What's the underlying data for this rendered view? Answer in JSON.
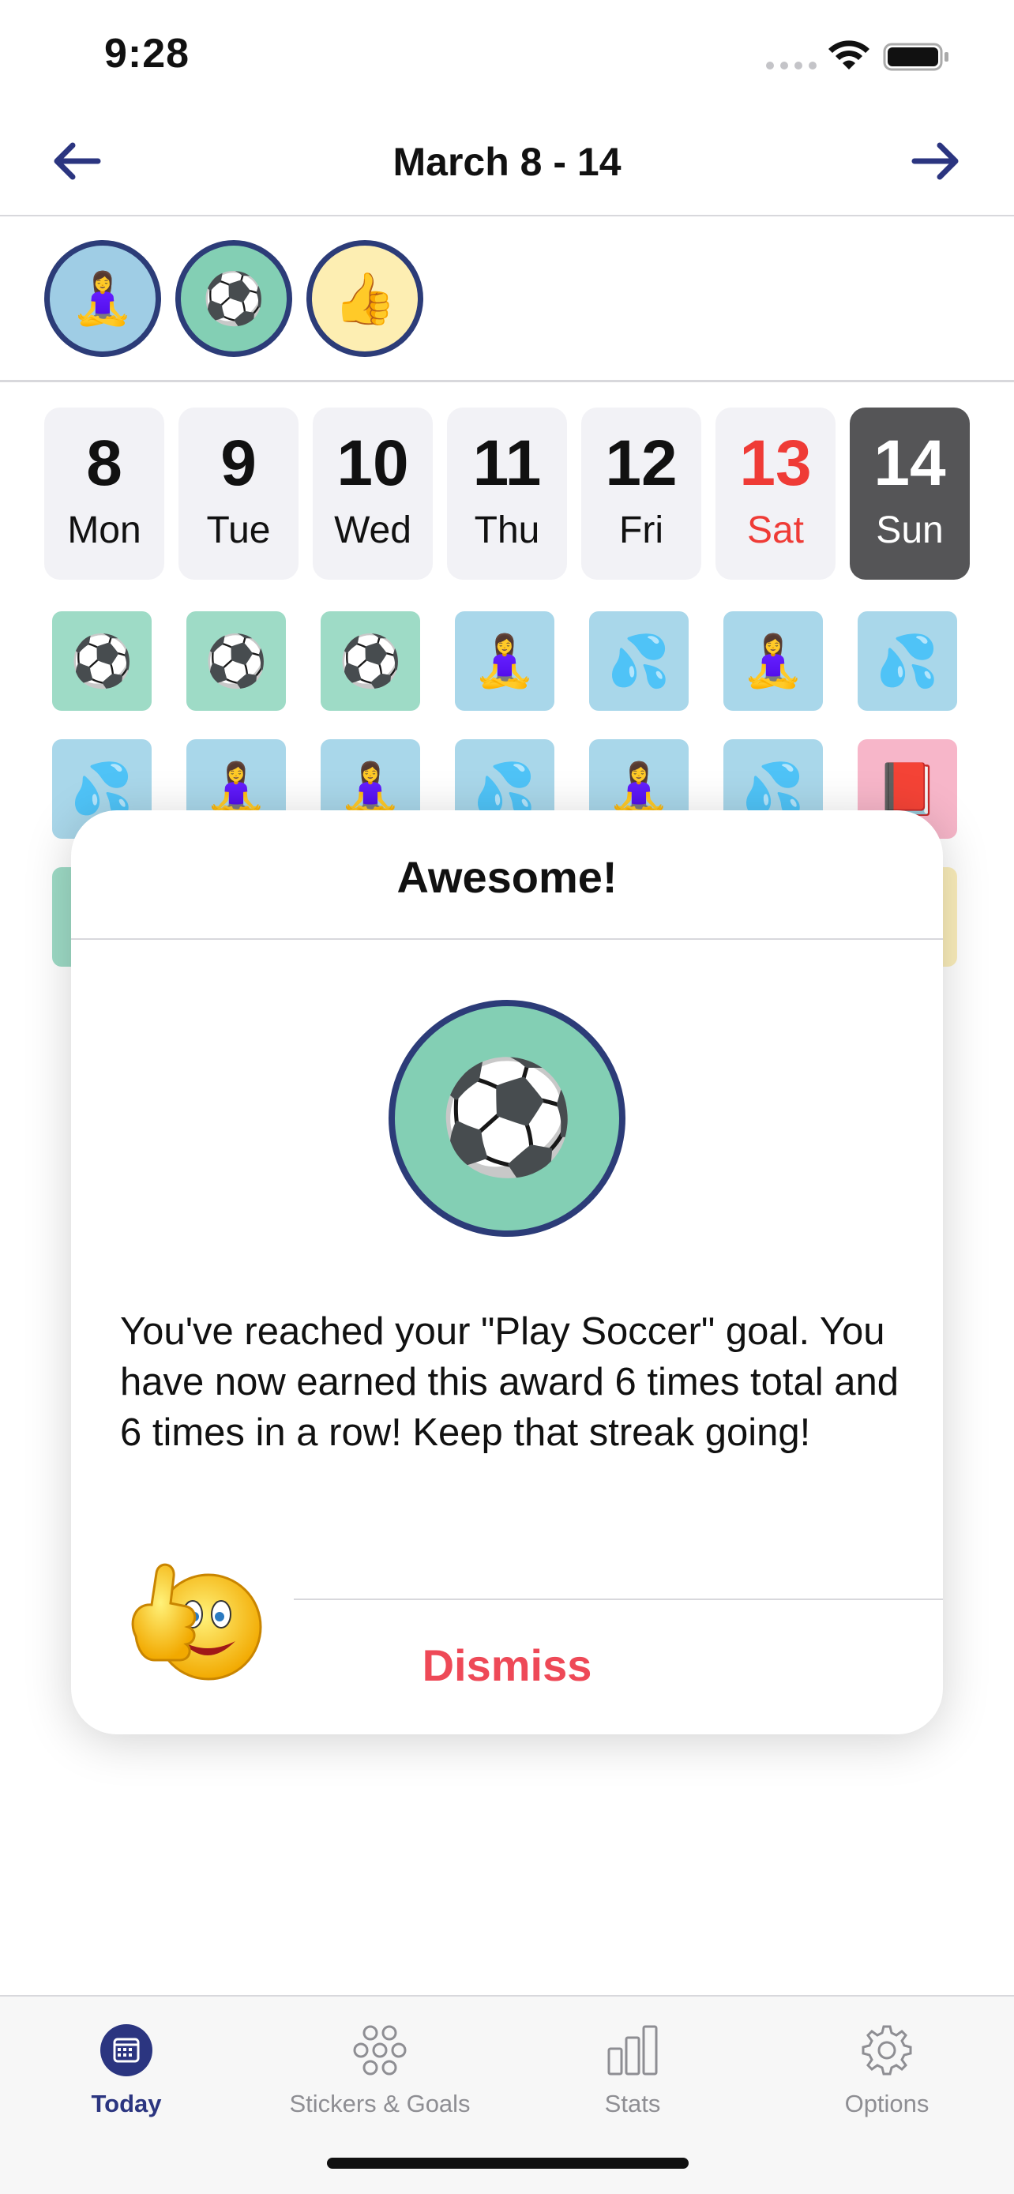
{
  "status_bar": {
    "time": "9:28"
  },
  "header": {
    "title": "March 8 - 14",
    "prev_icon": "arrow-left-icon",
    "next_icon": "arrow-right-icon"
  },
  "award_strip": [
    {
      "emoji": "🧘‍♀️",
      "bg": "#9fcde5"
    },
    {
      "emoji": "⚽",
      "bg": "#83cfb4"
    },
    {
      "emoji": "👍",
      "bg": "#fdeeb2"
    }
  ],
  "days": [
    {
      "num": "8",
      "name": "Mon"
    },
    {
      "num": "9",
      "name": "Tue"
    },
    {
      "num": "10",
      "name": "Wed"
    },
    {
      "num": "11",
      "name": "Thu"
    },
    {
      "num": "12",
      "name": "Fri"
    },
    {
      "num": "13",
      "name": "Sat"
    },
    {
      "num": "14",
      "name": "Sun"
    }
  ],
  "sticker_rows": [
    [
      "⚽",
      "⚽",
      "⚽",
      "🧘‍♀️",
      "💦",
      "🧘‍♀️",
      "💦"
    ],
    [
      "💦",
      "🧘‍♀️",
      "🧘‍♀️",
      "💦",
      "🧘‍♀️",
      "💦",
      "📕"
    ]
  ],
  "colors": {
    "soccer_bg": "#9edbc6",
    "blue_bg": "#a9d7ea",
    "book_bg": "#f7b6c9",
    "accent": "#2b3580",
    "weekend": "#ef3b36",
    "dismiss": "#ee4957"
  },
  "modal": {
    "title": "Awesome!",
    "award_emoji": "⚽",
    "message": "You've reached your \"Play Soccer\" goal. You have now earned this award 6 times total and 6 times in a row! Keep that streak going!",
    "mascot_icon": "thumbs-up-smiley-icon",
    "dismiss_label": "Dismiss"
  },
  "tabs": [
    {
      "label": "Today",
      "icon": "calendar-icon"
    },
    {
      "label": "Stickers & Goals",
      "icon": "stickers-icon"
    },
    {
      "label": "Stats",
      "icon": "bar-chart-icon"
    },
    {
      "label": "Options",
      "icon": "gear-icon"
    }
  ]
}
